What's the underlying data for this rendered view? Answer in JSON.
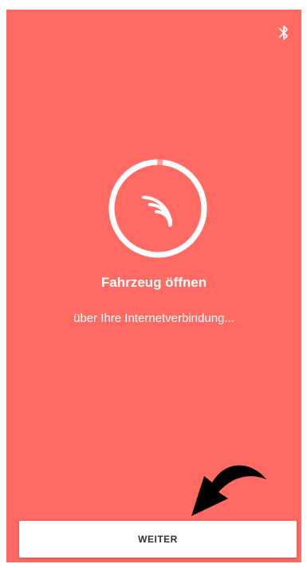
{
  "colors": {
    "background": "#ff6b63",
    "foreground": "#ffffff",
    "button_text": "#333333",
    "arrow": "#000000"
  },
  "status_bar": {
    "icon": "bluetooth-icon"
  },
  "unlock": {
    "progress_icon": "nfc-signal-icon",
    "progress": 0.98,
    "title": "Fahrzeug öffnen",
    "subtitle": "über Ihre Internetverbindung..."
  },
  "annotation": {
    "icon": "curved-arrow-icon"
  },
  "footer": {
    "continue_label": "WEITER"
  }
}
